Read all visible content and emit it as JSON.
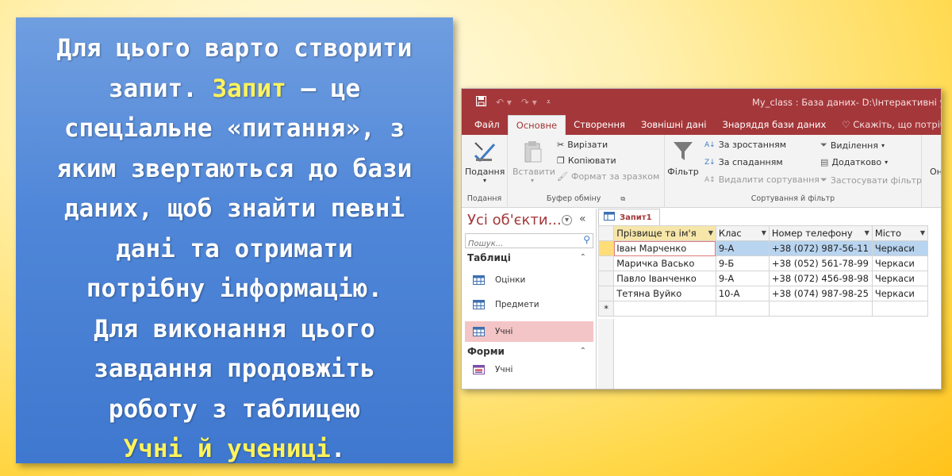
{
  "card": {
    "line1": "Для цього варто створити",
    "line2a": "запит. ",
    "line2b": "Запит",
    "line2c": " – це",
    "line3": "спеціальне «питання», з",
    "line4": "яким звертаються до бази",
    "line5": "даних, щоб знайти певні",
    "line6": "дані та отримати",
    "line7": "потрібну інформацію.",
    "line8": "Для виконання цього",
    "line9": "завдання продовжіть",
    "line10": "роботу з таблицею",
    "line11a": "Учні й учениці",
    "line11b": "."
  },
  "access": {
    "window_title": "My_class : База даних- D:\\Інтерактивні урок",
    "undo_icon": "undo-icon",
    "redo_icon": "redo-icon",
    "tabs": [
      "Файл",
      "Основне",
      "Створення",
      "Зовнішні дані",
      "Знаряддя бази даних"
    ],
    "tell_me": "Скажіть, що потрібно",
    "ribbon": {
      "view": {
        "label": "Подання",
        "group": "Подання"
      },
      "clipboard": {
        "paste": "Вставити",
        "cut": "Вирізати",
        "copy": "Копіювати",
        "format_painter": "Формат за зразком",
        "group": "Буфер обміну"
      },
      "sort_filter": {
        "filter": "Фільтр",
        "ascending": "За зростанням",
        "descending": "За спаданням",
        "remove_sort": "Видалити сортування",
        "selection": "Виділення",
        "advanced": "Додатково",
        "toggle_filter": "Застосувати фільтр",
        "group": "Сортування й фільтр"
      },
      "cut_off": "Он"
    },
    "nav": {
      "title": "Усі об'єкти...",
      "search_placeholder": "Пошук...",
      "tables_header": "Таблиці",
      "tables": [
        "Оцінки",
        "Предмети",
        "Учні"
      ],
      "forms_header": "Форми",
      "forms": [
        "Учні"
      ]
    },
    "query_tab": "Запит1",
    "grid": {
      "headers": [
        "Прізвище та ім'я",
        "Клас",
        "Номер телефону",
        "Місто"
      ],
      "rows": [
        [
          "Іван Марченко",
          "9-А",
          "+38 (072) 987-56-11",
          "Черкаси"
        ],
        [
          "Маричка Васько",
          "9-Б",
          "+38 (052) 561-78-99",
          "Черкаси"
        ],
        [
          "Павло Іванченко",
          "9-А",
          "+38 (072) 456-98-98",
          "Черкаси"
        ],
        [
          "Тетяна Вуйко",
          "10-А",
          "+38 (074) 987-98-25",
          "Черкаси"
        ]
      ],
      "new_row_marker": "*"
    }
  }
}
